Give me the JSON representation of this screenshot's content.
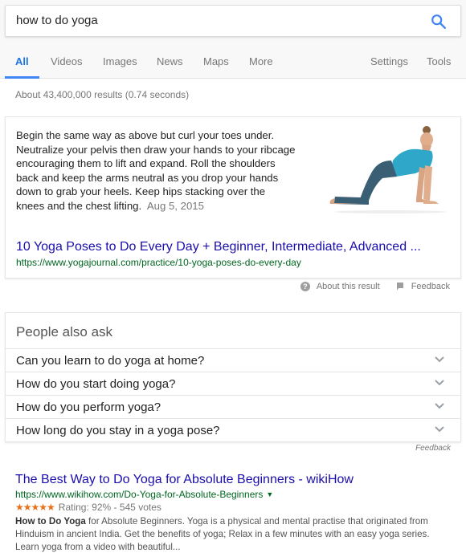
{
  "search": {
    "query": "how to do yoga"
  },
  "tabs": [
    "All",
    "Videos",
    "Images",
    "News",
    "Maps",
    "More"
  ],
  "tools": {
    "settings": "Settings",
    "tools": "Tools"
  },
  "stats": "About 43,400,000 results (0.74 seconds)",
  "featured": {
    "snippet": "Begin the same way as above but curl your toes under. Neutralize your pelvis then draw your hands to your ribcage encouraging them to lift and expand. Roll the shoulders back and keep the arms neutral as you drop your hands down to grab your heels. Keep hips stacking over the knees and the chest lifting.",
    "date": "Aug 5, 2015",
    "title": "10 Yoga Poses to Do Every Day + Beginner, Intermediate, Advanced ...",
    "url": "https://www.yogajournal.com/practice/10-yoga-poses-do-every-day"
  },
  "snippet_feedback": {
    "about": "About this result",
    "feedback": "Feedback"
  },
  "paa": {
    "title": "People also ask",
    "questions": [
      "Can you learn to do yoga at home?",
      "How do you start doing yoga?",
      "How do you perform yoga?",
      "How long do you stay in a yoga pose?"
    ],
    "feedback": "Feedback"
  },
  "result": {
    "title": "The Best Way to Do Yoga for Absolute Beginners - wikiHow",
    "url": "https://www.wikihow.com/Do-Yoga-for-Absolute-Beginners",
    "stars": "★★★★★",
    "rating": "Rating: 92% - 545 votes",
    "snippet_bold": "How to Do Yoga",
    "snippet_rest": " for Absolute Beginners. Yoga is a physical and mental practise that originated from Hinduism in ancient India. Get the benefits of yoga; Relax in a few minutes with an easy yoga series. Learn yoga from a video with beautiful..."
  },
  "colors": {
    "link": "#1a0dab",
    "url": "#006621",
    "accent": "#4285f4",
    "star": "#e7711b"
  },
  "icons": [
    "search-icon",
    "help-icon",
    "flag-icon",
    "chevron-down-icon",
    "caret-down-icon"
  ]
}
